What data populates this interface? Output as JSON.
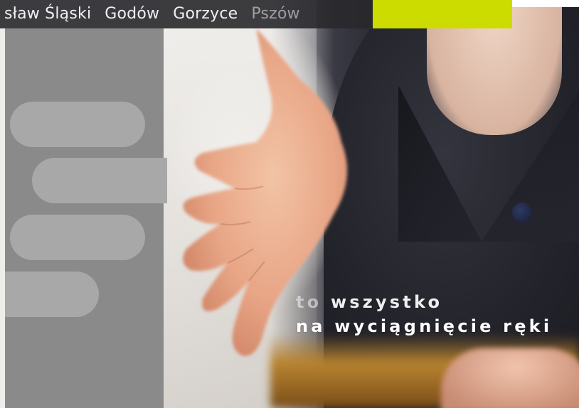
{
  "nav": {
    "items": [
      {
        "label": "sław Śląski"
      },
      {
        "label": "Godów"
      },
      {
        "label": "Gorzyce"
      },
      {
        "label": "Pszów"
      }
    ]
  },
  "tagline": {
    "line1_a": "to",
    "line1_b": "wszystko",
    "line2": "na wyciągnięcie ręki"
  },
  "colors": {
    "accent": "#cddc00",
    "nav_bg": "#28282c",
    "panel": "#8a8a8a",
    "pill": "#a8a8a8"
  },
  "icons": [
    "hand-photo"
  ]
}
